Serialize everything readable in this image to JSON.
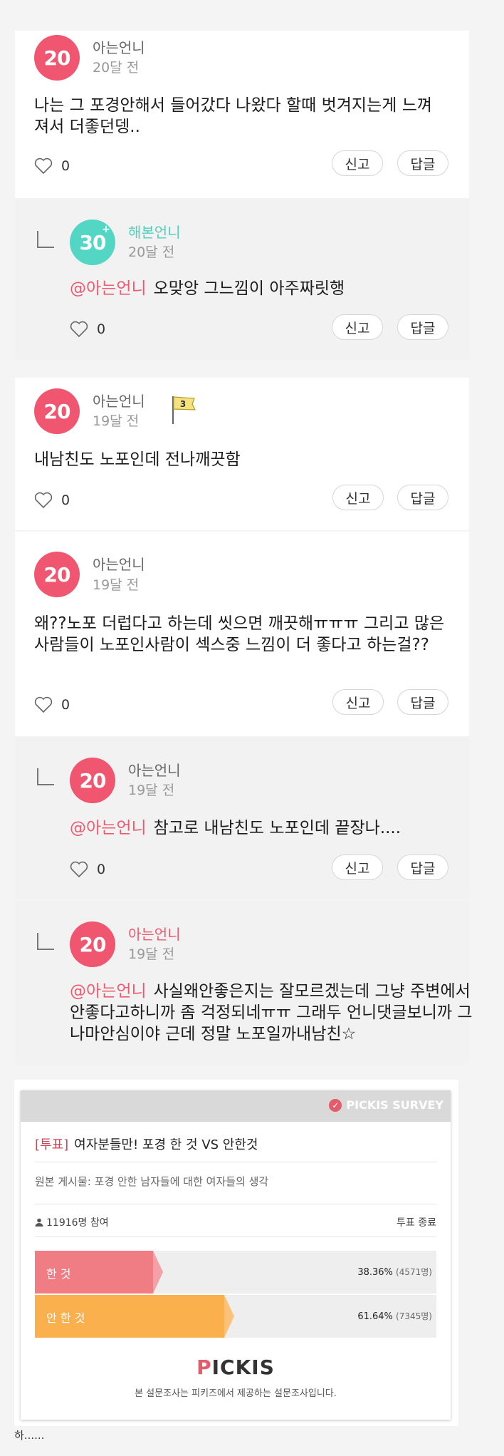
{
  "comments": [
    {
      "avatar": "20",
      "nick": "아는언니",
      "time": "20달 전",
      "text": "나는 그 포경안해서 들어갔다 나왔다 할때 벗겨지는게 느껴져서 더좋던뎅..",
      "likes": "0",
      "report": "신고",
      "reply": "답글"
    },
    {
      "avatar": "30",
      "avatar_sup": "+",
      "nick": "해본언니",
      "time": "20달 전",
      "mention": "@아는언니",
      "text": "오맞앙 그느낌이 아주짜릿행",
      "likes": "0",
      "report": "신고",
      "reply": "답글"
    },
    {
      "avatar": "20",
      "nick": "아는언니",
      "time": "19달 전",
      "flag": "3",
      "text": "내남친도 노포인데 전나깨끗함",
      "likes": "0",
      "report": "신고",
      "reply": "답글"
    },
    {
      "avatar": "20",
      "nick": "아는언니",
      "time": "19달 전",
      "text": "왜??노포 더럽다고 하는데  씻으면 깨끗해ㅠㅠㅠ   그리고 많은 사람들이 노포인사람이 섹스중 느낌이 더 좋다고 하는걸??",
      "likes": "0",
      "report": "신고",
      "reply": "답글"
    },
    {
      "avatar": "20",
      "nick": "아는언니",
      "time": "19달 전",
      "mention": "@아는언니",
      "text": "참고로 내남친도 노포인데   끝장나....",
      "likes": "0",
      "report": "신고",
      "reply": "답글"
    },
    {
      "avatar": "20",
      "nick": "아는언니",
      "time": "19달 전",
      "mention": "@아는언니",
      "text": "사실왜안좋은지는 잘모르겠는데 그냥 주변에서 안좋다고하니까 좀 걱정되네ㅠㅠ 그래두 언니댓글보니까 그나마안심이야 근데 정말 노포일까내남친☆"
    }
  ],
  "survey": {
    "brand": "PICKIS SURVEY",
    "tag": "[투표]",
    "title": "여자분들만! 포경 한 것 VS 안한것",
    "source": "원본 게시물: 포경 안한 남자들에 대한 여자들의 생각",
    "participants": "11916명 참여",
    "status": "투표 종료",
    "options": [
      {
        "label": "한 것",
        "percent": "38.36%",
        "count": "(4571명)",
        "ratio": 0.3836,
        "color": "#f07c84",
        "tip": "#f5a0a6"
      },
      {
        "label": "안 한 것",
        "percent": "61.64%",
        "count": "(7345명)",
        "ratio": 0.6164,
        "color": "#fbb04e",
        "tip": "#fcc27a"
      }
    ],
    "logo_p": "P",
    "logo_rest": "ICKIS",
    "footer": "본 설문조사는 피키즈에서 제공하는 설문조사입니다."
  },
  "bottom_text": "하......"
}
